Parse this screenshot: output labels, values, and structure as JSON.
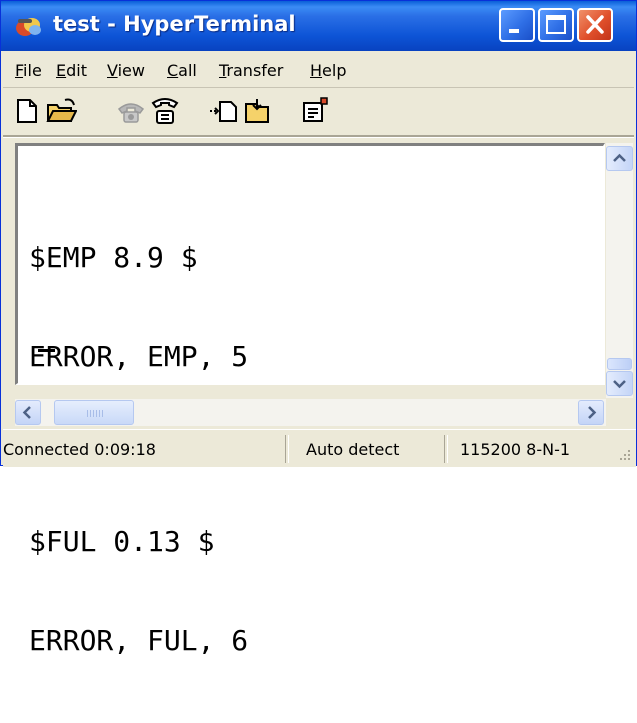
{
  "window": {
    "title": "test - HyperTerminal"
  },
  "menu": [
    "File",
    "Edit",
    "View",
    "Call",
    "Transfer",
    "Help"
  ],
  "toolbar": {
    "icons": [
      "new-document-icon",
      "open-folder-icon",
      "connect-phone-icon",
      "disconnect-phone-icon",
      "send-icon",
      "receive-icon",
      "properties-icon"
    ]
  },
  "terminal": {
    "lines": [
      "$EMP 8.9 $",
      "ERROR, EMP, 5",
      "$FUL 0.13 $",
      "ERROR, FUL, 6"
    ]
  },
  "status": {
    "connection": "Connected 0:09:18",
    "detect": "Auto detect",
    "settings": "115200 8-N-1"
  },
  "colors": {
    "titlebar": "#0d54d6",
    "chrome": "#ece9d8",
    "close_button": "#e0502b"
  }
}
